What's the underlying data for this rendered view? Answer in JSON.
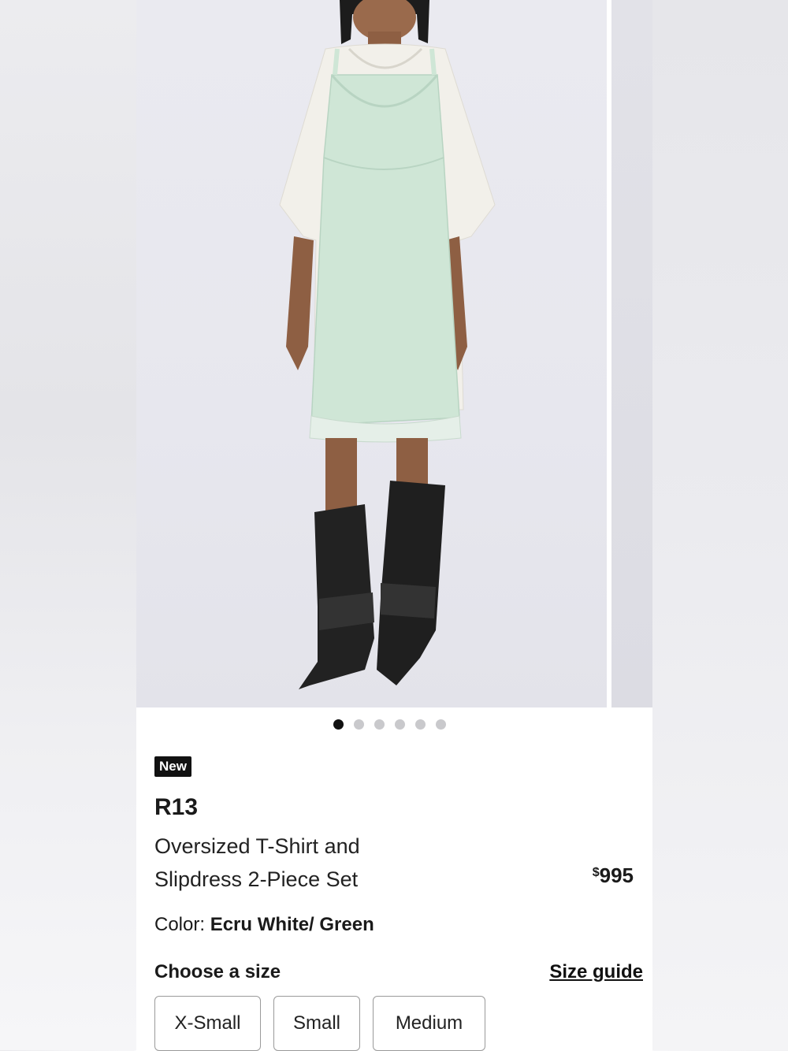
{
  "gallery": {
    "image_alt": "Model wearing white oversized t-shirt under green lace slipdress with black boots",
    "dots_total": 6,
    "active_dot": 1
  },
  "product": {
    "badge": "New",
    "brand": "R13",
    "title_line1": "Oversized T-Shirt and",
    "title_line2": "Slipdress 2-Piece Set",
    "price_symbol": "$",
    "price_value": "995",
    "color_label": "Color:",
    "color_value": "Ecru White/ Green"
  },
  "size_selector": {
    "heading": "Choose a size",
    "guide_link": "Size guide",
    "options": [
      "X-Small",
      "Small",
      "Medium"
    ]
  },
  "colors": {
    "badge_bg": "#111111",
    "dot_active": "#111111",
    "dot_inactive": "#c9c9cc",
    "dress": "#cfe6d6",
    "boots": "#1f1f1f"
  }
}
